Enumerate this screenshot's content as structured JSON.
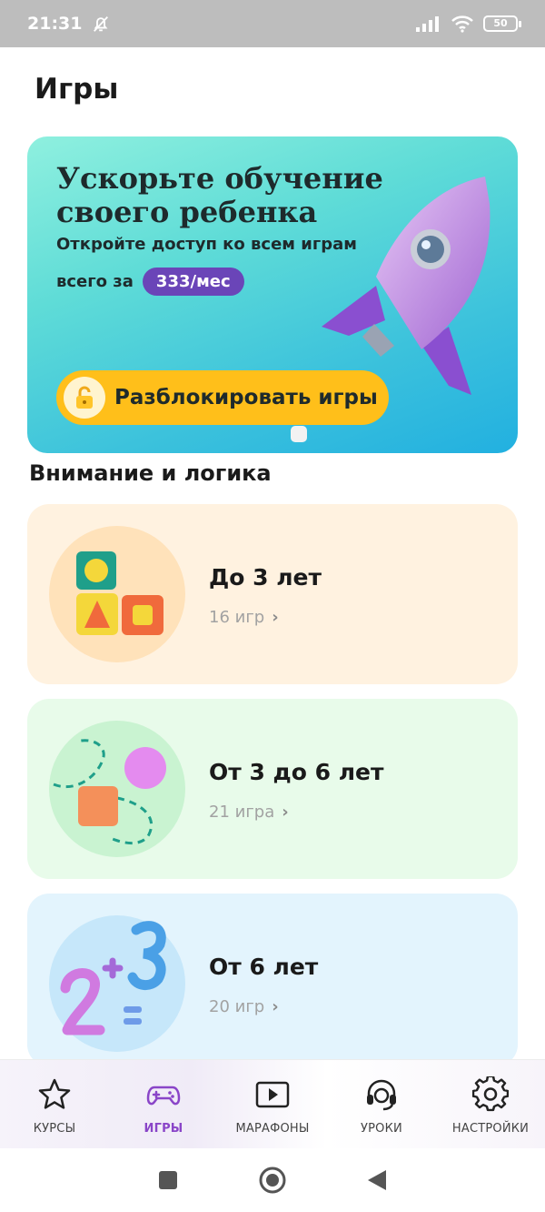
{
  "status_bar": {
    "time": "21:31",
    "battery": "50"
  },
  "page": {
    "title": "Игры"
  },
  "banner": {
    "headline": "Ускорьте обучение своего ребенка",
    "subtitle": "Откройте доступ ко всем играм",
    "price_prefix": "всего за",
    "price": "333/мес",
    "unlock_label": "Разблокировать игры"
  },
  "section": {
    "title": "Внимание и логика"
  },
  "categories": [
    {
      "title": "До 3 лет",
      "count": "16 игр"
    },
    {
      "title": "От 3 до 6 лет",
      "count": "21 игра"
    },
    {
      "title": "От 6 лет",
      "count": "20 игр"
    }
  ],
  "bottom_nav": [
    {
      "label": "КУРСЫ",
      "icon": "star-icon",
      "active": false
    },
    {
      "label": "ИГРЫ",
      "icon": "gamepad-icon",
      "active": true
    },
    {
      "label": "МАРАФОНЫ",
      "icon": "play-icon",
      "active": false
    },
    {
      "label": "УРОКИ",
      "icon": "headset-icon",
      "active": false
    },
    {
      "label": "НАСТРОЙКИ",
      "icon": "gear-icon",
      "active": false
    }
  ],
  "colors": {
    "accent": "#8a45c8",
    "price_pill": "#6a45b8",
    "unlock_button": "#ffbf1a"
  }
}
